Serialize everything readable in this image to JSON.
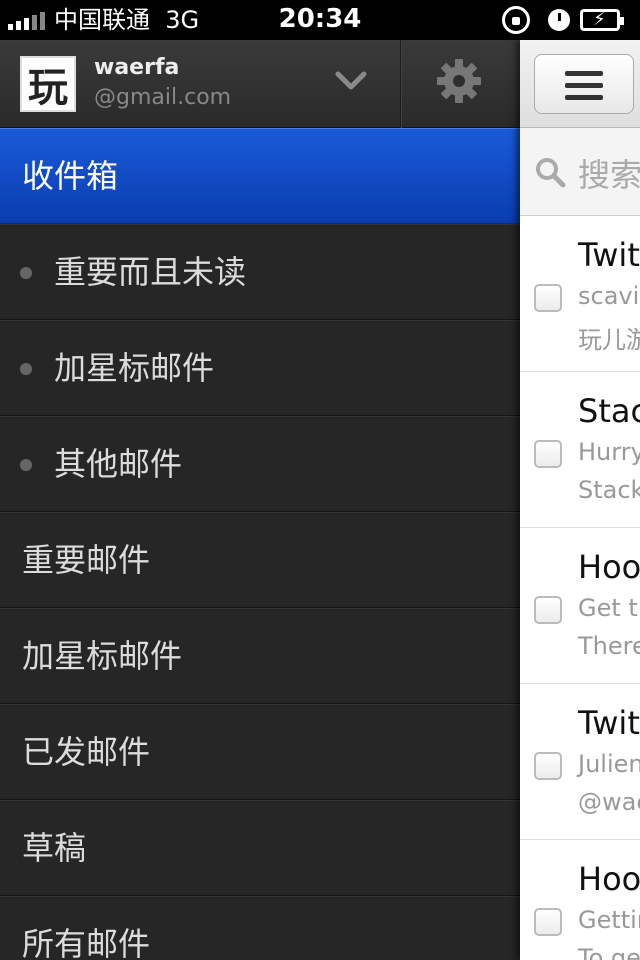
{
  "status_bar": {
    "carrier": "中国联通",
    "network": "3G",
    "time": "20:34"
  },
  "account": {
    "avatar_text": "玩",
    "name": "waerfa",
    "email": "@gmail.com"
  },
  "menu_items": [
    {
      "label": "收件箱",
      "active": true,
      "sub": false
    },
    {
      "label": "重要而且未读",
      "active": false,
      "sub": true
    },
    {
      "label": "加星标邮件",
      "active": false,
      "sub": true
    },
    {
      "label": "其他邮件",
      "active": false,
      "sub": true
    },
    {
      "label": "重要邮件",
      "active": false,
      "sub": false
    },
    {
      "label": "加星标邮件",
      "active": false,
      "sub": false
    },
    {
      "label": "已发邮件",
      "active": false,
      "sub": false
    },
    {
      "label": "草稿",
      "active": false,
      "sub": false
    },
    {
      "label": "所有邮件",
      "active": false,
      "sub": false
    }
  ],
  "search": {
    "placeholder": "搜索"
  },
  "mails": [
    {
      "sender": "Twitt",
      "subject": "scavin",
      "snippet": "玩儿游"
    },
    {
      "sender": "Stack",
      "subject": "Hurry",
      "snippet": "Stack"
    },
    {
      "sender": "Hoot",
      "subject": "Get th",
      "snippet": "There"
    },
    {
      "sender": "Twitt",
      "subject": "Julien",
      "snippet": "@wae"
    },
    {
      "sender": "Hoot",
      "subject": "Gettin",
      "snippet": "To ge"
    }
  ],
  "colors": {
    "active_blue": "#1a5ad8",
    "menu_bg": "#262626"
  }
}
